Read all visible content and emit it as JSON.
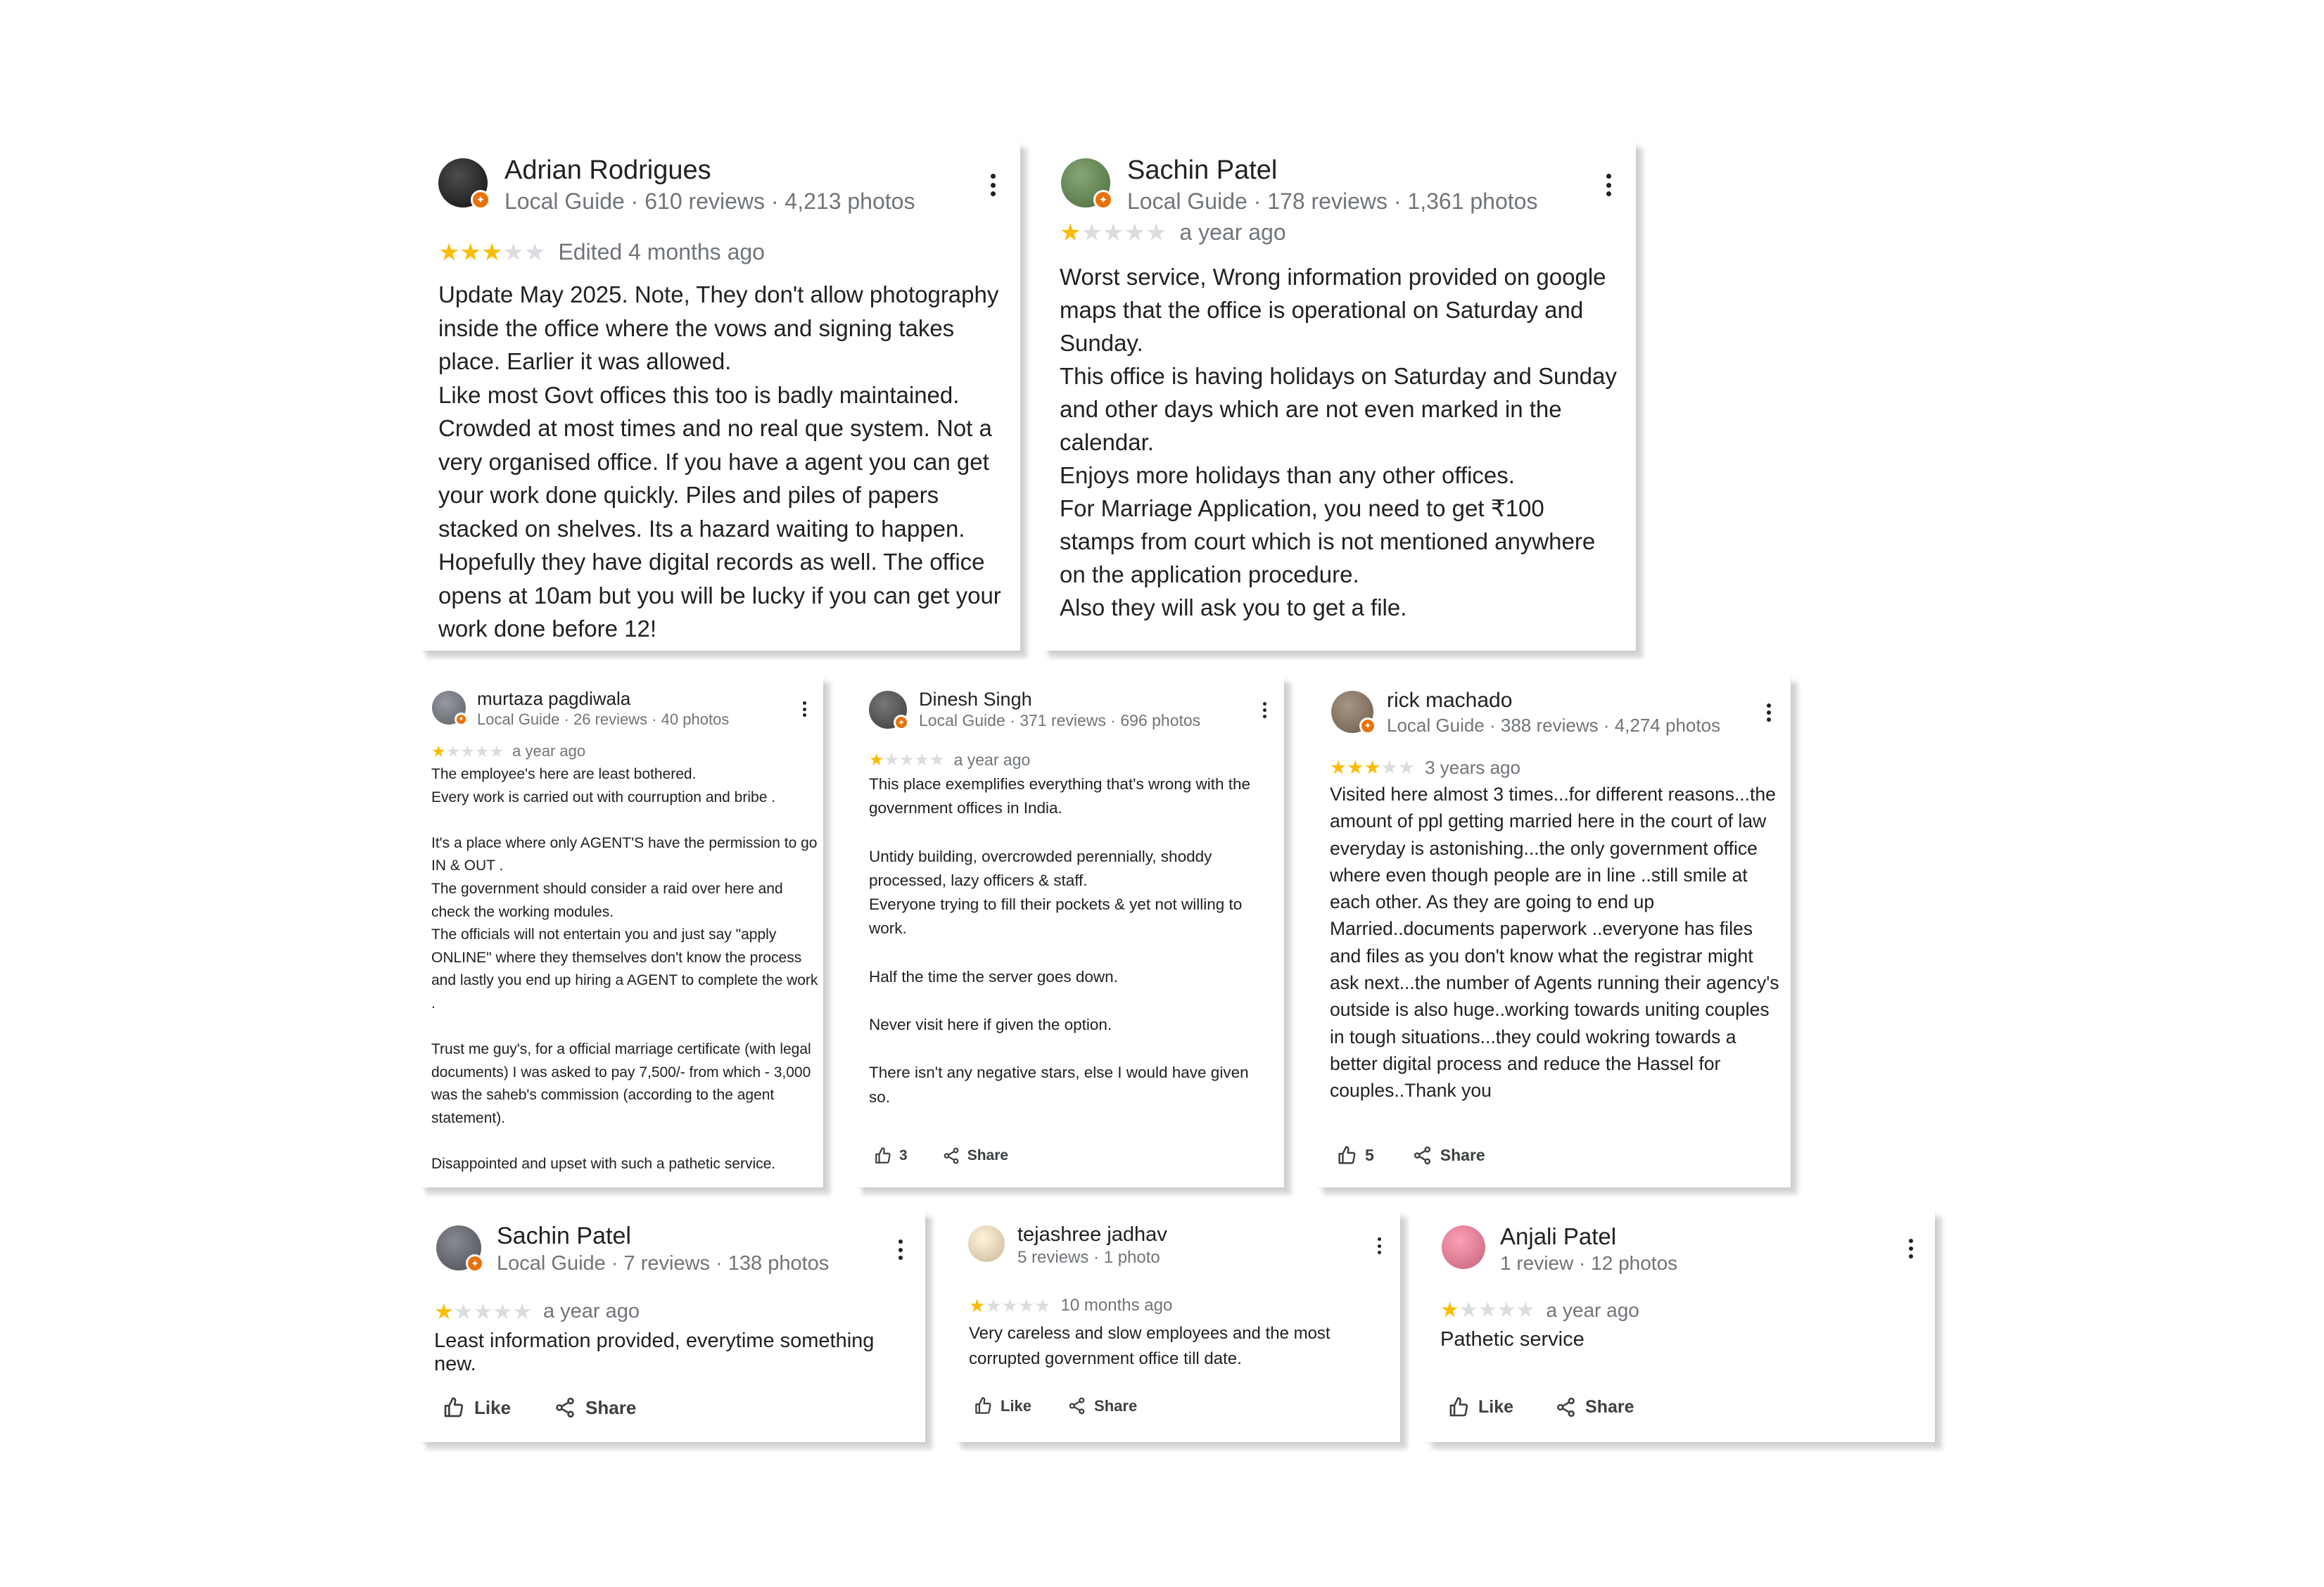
{
  "reviews": [
    {
      "name": "Adrian Rodrigues",
      "meta": "Local Guide · 610 reviews · 4,213 photos",
      "rating": 3,
      "age": "Edited 4 months ago",
      "text": "Update May 2025. Note, They don't allow photography inside the office where the vows and signing takes place. Earlier it was allowed.\nLike most Govt offices this too is badly maintained. Crowded at most times and no real que system. Not a very organised office. If you have a agent you can get your work done quickly. Piles and piles of papers stacked on shelves. Its a hazard waiting to happen. Hopefully they have digital records as well. The office opens at 10am but you will be lucky if you can get your work done before 12!",
      "avatar_color": "#111111",
      "local_guide": true
    },
    {
      "name": "Sachin Patel",
      "meta": "Local Guide · 178 reviews · 1,361 photos",
      "rating": 1,
      "age": "a year ago",
      "text": "Worst service, Wrong information provided on google maps that the office is operational on Saturday and Sunday.\nThis office is having holidays on Saturday and Sunday and other days which are not even marked in the calendar.\nEnjoys more holidays than any other offices.\nFor Marriage Application, you need to get ₹100 stamps from court which is not  mentioned anywhere on the application procedure.\nAlso they will ask you to get a file.",
      "avatar_color": "#4a6b3a",
      "local_guide": true
    },
    {
      "name": "murtaza pagdiwala",
      "meta": "Local Guide · 26 reviews · 40 photos",
      "rating": 1,
      "age": "a year ago",
      "text": "The employee's here are least bothered.\nEvery work is carried out with courruption and bribe .\n\nIt's a place where only AGENT'S have the permission to go IN & OUT .\nThe government should consider a raid over here and check the working modules.\nThe officials will not entertain you and just say \"apply ONLINE\" where they themselves don't know the process and lastly you end up hiring a AGENT to complete the work .\n\nTrust me guy's, for a official marriage certificate (with legal documents) I was asked to pay 7,500/- from which - 3,000 was the saheb's commission (according to the agent statement).\n\nDisappointed and upset with such a pathetic service.",
      "avatar_color": "#5a5f66",
      "local_guide": true
    },
    {
      "name": "Dinesh Singh",
      "meta": "Local Guide · 371 reviews · 696 photos",
      "rating": 1,
      "age": "a year ago",
      "text": "This place exemplifies everything that's wrong with the government offices in India.\n\nUntidy building, overcrowded perennially, shoddy processed, lazy officers & staff.\nEveryone trying to fill their pockets & yet not willing to work.\n\nHalf the time the server goes down.\n\nNever visit here if given the option.\n\nThere isn't any negative stars, else I would have given so.",
      "avatar_color": "#3b3b3b",
      "local_guide": true,
      "likes": "3",
      "share": "Share"
    },
    {
      "name": "rick machado",
      "meta": "Local Guide · 388 reviews · 4,274 photos",
      "rating": 3,
      "age": "3 years ago",
      "text": "Visited here almost 3 times...for different reasons...the amount of ppl getting married here in the court of law everyday is astonishing...the only government office where even though people are in line ..still smile at each other. As they are going to end up Married..documents paperwork ..everyone has files and files as you don't know what the registrar might ask next...the number of Agents running their agency's outside is also huge..working towards uniting couples in tough situations...they could wokring towards a better digital process and reduce the Hassel for couples..Thank you",
      "avatar_color": "#6b5a4a",
      "local_guide": true,
      "likes": "5",
      "share": "Share"
    },
    {
      "name": "Sachin Patel",
      "meta": "Local Guide · 7 reviews · 138 photos",
      "rating": 1,
      "age": "a year ago",
      "text": "Least information provided, everytime something new.",
      "avatar_color": "#4b4f55",
      "local_guide": true,
      "like": "Like",
      "share": "Share"
    },
    {
      "name": "tejashree jadhav",
      "meta": "5 reviews · 1 photo",
      "rating": 1,
      "age": "10 months ago",
      "text": "Very careless and slow employees and the most corrupted government office till date.",
      "avatar_color": "#c9b79c",
      "local_guide": false,
      "like": "Like",
      "share": "Share"
    },
    {
      "name": "Anjali Patel",
      "meta": "1 review · 12 photos",
      "rating": 1,
      "age": "a year ago",
      "text": "Pathetic service",
      "avatar_color": "#c2637a",
      "local_guide": false,
      "like": "Like",
      "share": "Share"
    }
  ],
  "icons": {
    "menu": "more-vert-icon",
    "like": "thumb-up-icon",
    "share": "share-icon",
    "star": "star-icon",
    "badge": "local-guide-badge-icon"
  },
  "colors": {
    "star_on": "#fbbc04",
    "star_off": "#dadce0",
    "badge": "#e8710a"
  }
}
